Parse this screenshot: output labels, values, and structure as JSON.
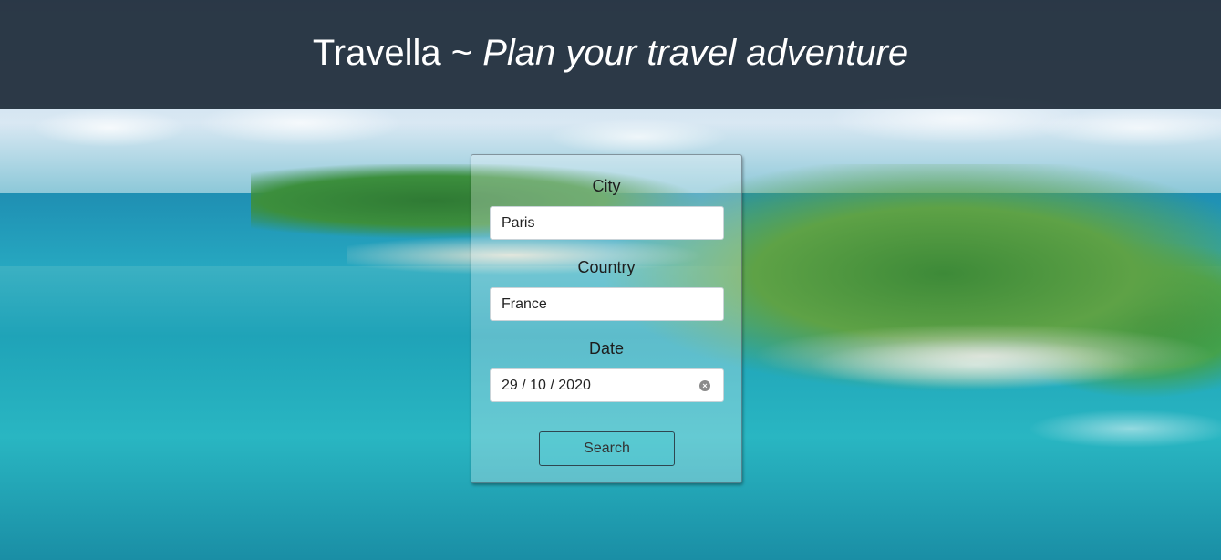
{
  "header": {
    "brand": "Travella ~ ",
    "tagline": "Plan your travel adventure"
  },
  "form": {
    "city": {
      "label": "City",
      "value": "Paris"
    },
    "country": {
      "label": "Country",
      "value": "France"
    },
    "date": {
      "label": "Date",
      "value": "29 / 10 / 2020",
      "clear_icon": "clear-circle-icon"
    },
    "search_label": "Search"
  },
  "colors": {
    "header_bg": "#1f2c3a",
    "text_light": "#ffffff",
    "button_border": "#2e4650"
  }
}
